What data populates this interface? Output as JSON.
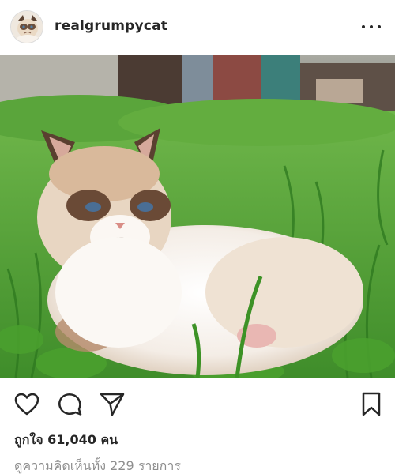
{
  "post": {
    "username": "realgrumpycat",
    "likes_text": "ถูกใจ 61,040 คน",
    "comments_text": "ดูความคิดเห็นทั้ง 229 รายการ"
  },
  "icons": {
    "more": "more-options-icon",
    "like": "heart-icon",
    "comment": "comment-icon",
    "share": "paper-plane-icon",
    "save": "bookmark-icon"
  },
  "colors": {
    "text": "#262626",
    "secondary": "#8e8e8e",
    "divider": "#dbdbdb"
  }
}
